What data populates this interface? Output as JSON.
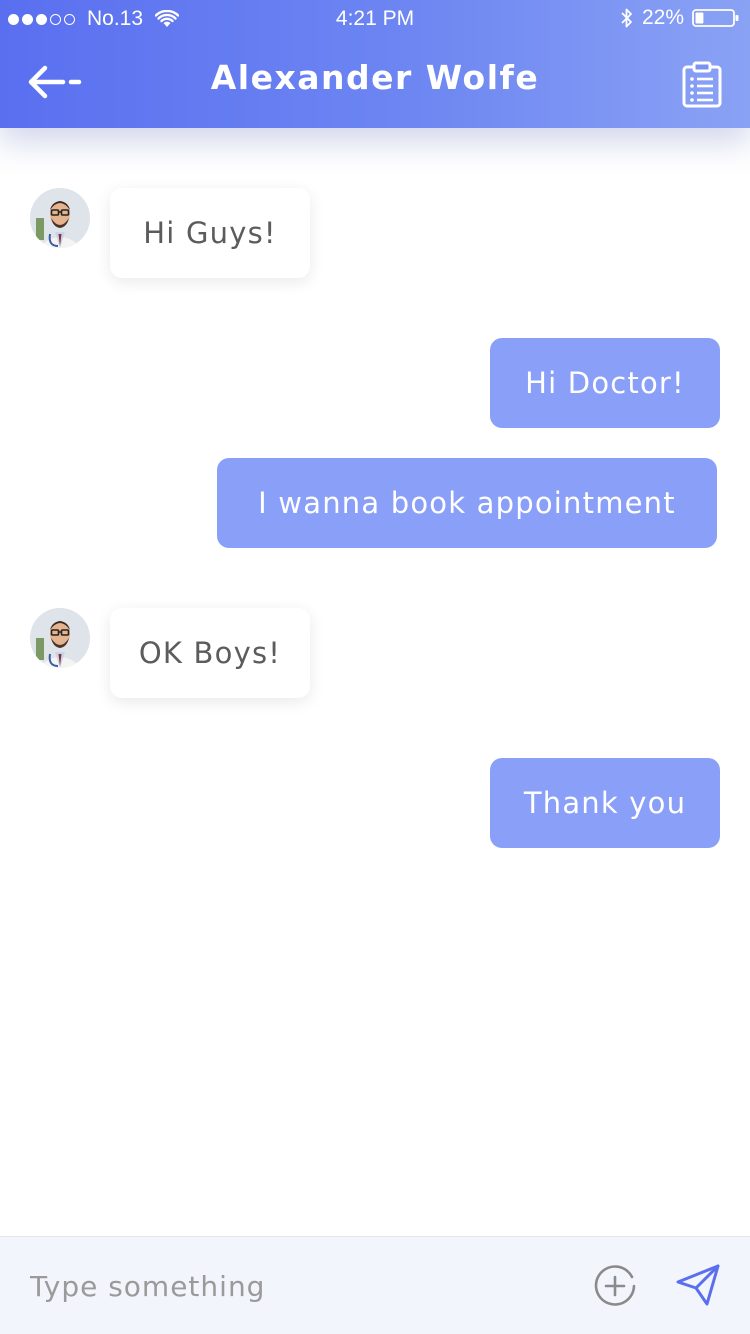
{
  "status_bar": {
    "signal_full": 3,
    "signal_total": 5,
    "carrier": "No.13",
    "time": "4:21 PM",
    "battery": "22%",
    "battery_level": 0.22,
    "icons": [
      "wifi-icon",
      "bluetooth-icon",
      "battery-icon"
    ]
  },
  "nav": {
    "title": "Alexander Wolfe",
    "back_icon": "back-arrow-icon",
    "action_icon": "clipboard-icon"
  },
  "messages": [
    {
      "direction": "incoming",
      "text": "Hi Guys!"
    },
    {
      "direction": "outgoing",
      "text": "Hi Doctor!"
    },
    {
      "direction": "outgoing",
      "text": "I wanna book appointment"
    },
    {
      "direction": "incoming",
      "text": "OK Boys!"
    },
    {
      "direction": "outgoing",
      "text": "Thank you"
    }
  ],
  "composer": {
    "placeholder": "Type something",
    "value": "",
    "add_icon": "add-circle-icon",
    "send_icon": "send-icon"
  },
  "colors": {
    "header_gradient_start": "#5a6ff0",
    "header_gradient_end": "#8aa2f4",
    "outgoing_bubble": "#8a9ff7",
    "incoming_bubble": "#ffffff",
    "incoming_text": "#5c5c5c",
    "send_icon": "#5a6ff0"
  }
}
